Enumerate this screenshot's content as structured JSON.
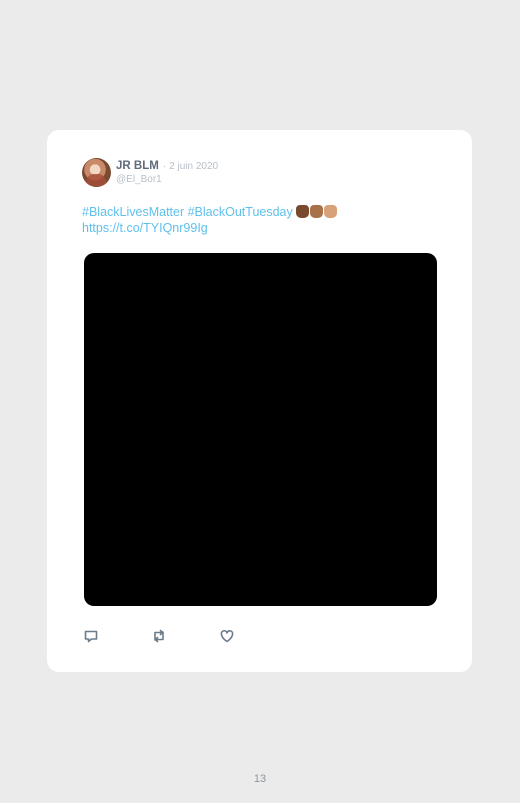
{
  "tweet": {
    "display_name": "JR BLM",
    "separator": "·",
    "date": "2 juin 2020",
    "handle": "@El_Bor1",
    "hashtag_1": "#BlackLivesMatter",
    "hashtag_2": "#BlackOutTuesday",
    "link": "https://t.co/TYIQnr99Ig",
    "emoji": [
      "raised-fist-dark",
      "raised-fist-medium",
      "raised-fist-light"
    ],
    "colors": {
      "link": "#5fc0ea",
      "name": "#5e6b7a",
      "muted": "#b7bfc8",
      "fist_dark": "#7a4a2e",
      "fist_medium": "#a9714a",
      "fist_light": "#d7a27a"
    }
  },
  "actions": [
    {
      "icon": "reply-icon"
    },
    {
      "icon": "retweet-icon"
    },
    {
      "icon": "like-icon"
    }
  ],
  "page": {
    "number": "13"
  }
}
